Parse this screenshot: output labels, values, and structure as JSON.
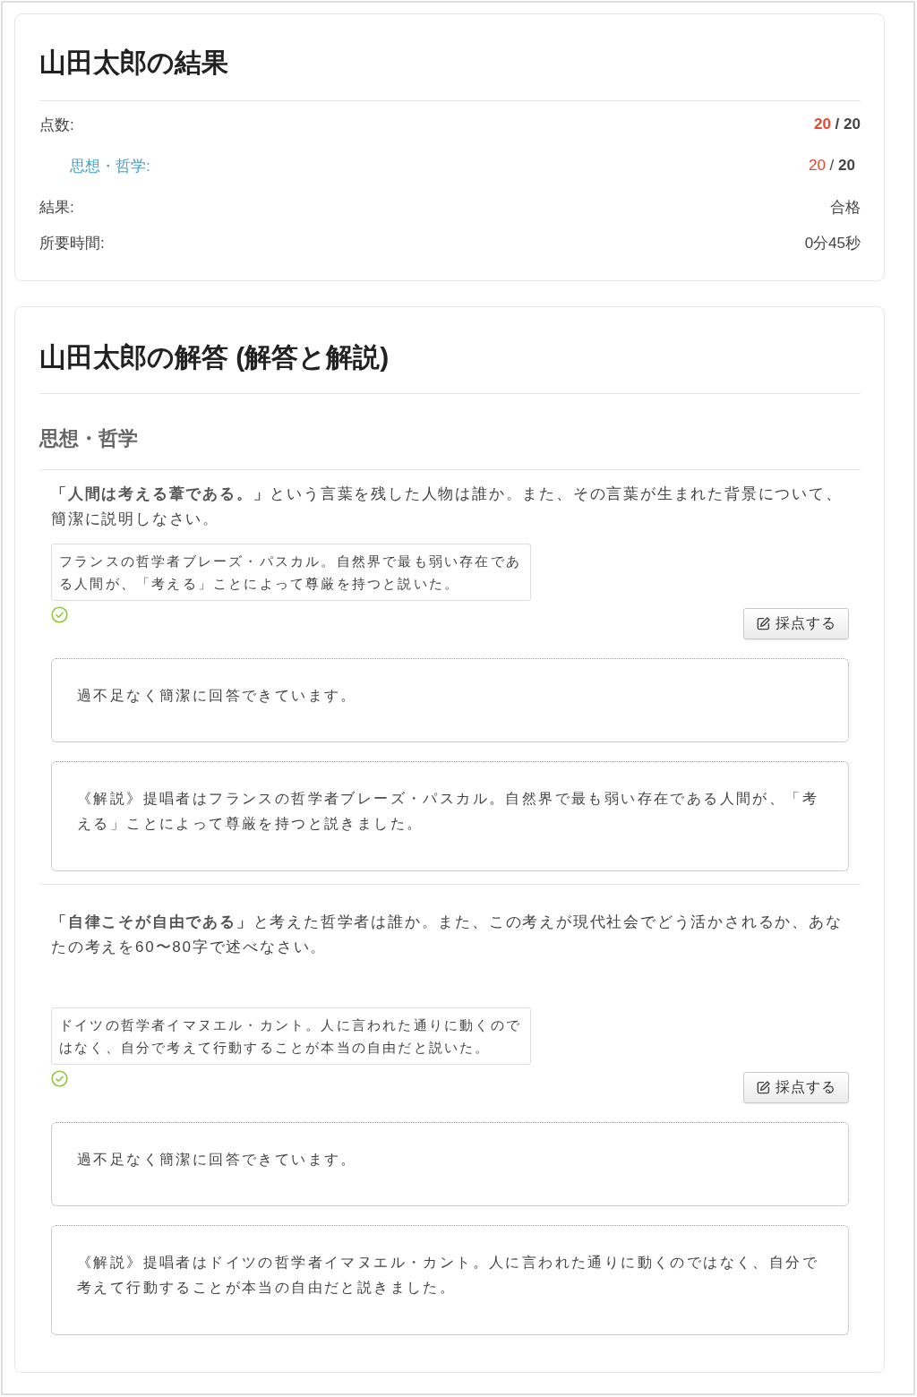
{
  "result": {
    "title": "山田太郎の結果",
    "rows": [
      {
        "kind": "score",
        "label": "点数:",
        "earned": "20",
        "separator": "/",
        "max": "20"
      },
      {
        "kind": "subscore",
        "label": "思想・哲学:",
        "earned": "20",
        "separator": "/",
        "max": "20"
      },
      {
        "kind": "text",
        "label": "結果:",
        "value": "合格"
      },
      {
        "kind": "text",
        "label": "所要時間:",
        "value": "0分45秒"
      }
    ]
  },
  "answers": {
    "title": "山田太郎の解答 (解答と解説)",
    "sections": [
      {
        "title": "思想・哲学",
        "questions": [
          {
            "question": "**「人間は考える葦である。」**という言葉を残した人物は誰か。また、その言葉が生まれた背景について、簡潔に説明しなさい。",
            "answer": "フランスの哲学者ブレーズ・パスカル。自然界で最も弱い存在である人間が、「考える」ことによって尊厳を持つと説いた。",
            "correct": true,
            "grade_button": "採点する",
            "feedback": "過不足なく簡潔に回答できています。",
            "explanation": "《解説》提唱者はフランスの哲学者ブレーズ・パスカル。自然界で最も弱い存在である人間が、「考える」ことによって尊厳を持つと説きました。"
          },
          {
            "question": "**「自律こそが自由である」**と考えた哲学者は誰か。また、この考えが現代社会でどう活かされるか、あなたの考えを60〜80字で述べなさい。",
            "answer": "ドイツの哲学者イマヌエル・カント。人に言われた通りに動くのではなく、自分で考えて行動することが本当の自由だと説いた。",
            "correct": true,
            "grade_button": "採点する",
            "feedback": "過不足なく簡潔に回答できています。",
            "explanation": "《解説》提唱者はドイツの哲学者イマヌエル・カント。人に言われた通りに動くのではなく、自分で考えて行動することが本当の自由だと説きました。"
          }
        ]
      }
    ]
  }
}
